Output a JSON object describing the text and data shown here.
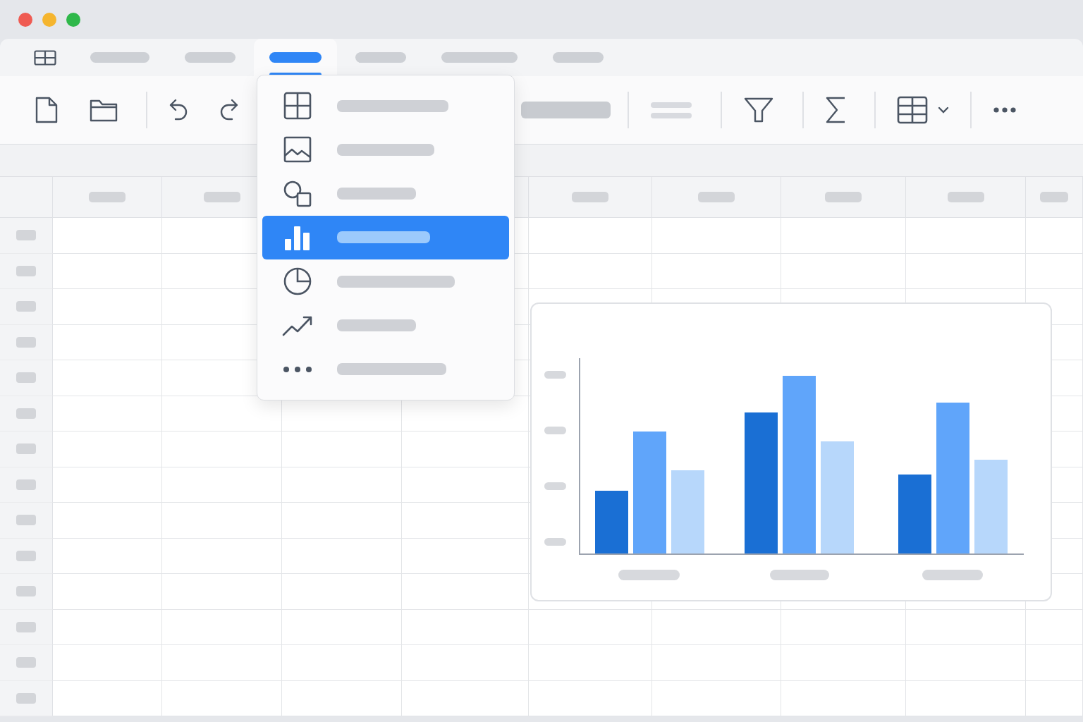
{
  "window": {
    "controls": [
      {
        "kind": "close"
      },
      {
        "kind": "minimize"
      },
      {
        "kind": "zoom"
      }
    ]
  },
  "tabs": [
    {
      "kind": "icon",
      "selected": false
    },
    {
      "kind": "label",
      "selected": false
    },
    {
      "kind": "label",
      "selected": false
    },
    {
      "kind": "label",
      "selected": true
    },
    {
      "kind": "label",
      "selected": false
    },
    {
      "kind": "label",
      "selected": false
    },
    {
      "kind": "label",
      "selected": false
    }
  ],
  "toolbar": [
    {
      "kind": "new"
    },
    {
      "kind": "open"
    },
    {
      "kind": "divider"
    },
    {
      "kind": "undo"
    },
    {
      "kind": "redo"
    },
    {
      "kind": "font"
    },
    {
      "kind": "divider"
    },
    {
      "kind": "align"
    },
    {
      "kind": "divider"
    },
    {
      "kind": "filter"
    },
    {
      "kind": "divider"
    },
    {
      "kind": "sum"
    },
    {
      "kind": "divider"
    },
    {
      "kind": "table"
    },
    {
      "kind": "divider"
    },
    {
      "kind": "more"
    }
  ],
  "insert_menu": {
    "expanded": true,
    "items": [
      {
        "kind": "table",
        "selected": false
      },
      {
        "kind": "image",
        "selected": false
      },
      {
        "kind": "shapes",
        "selected": false
      },
      {
        "kind": "chart",
        "selected": true
      },
      {
        "kind": "pie",
        "selected": false
      },
      {
        "kind": "trend",
        "selected": false
      },
      {
        "kind": "more",
        "selected": false
      }
    ]
  },
  "chart_card": {
    "kind": "bar"
  }
}
